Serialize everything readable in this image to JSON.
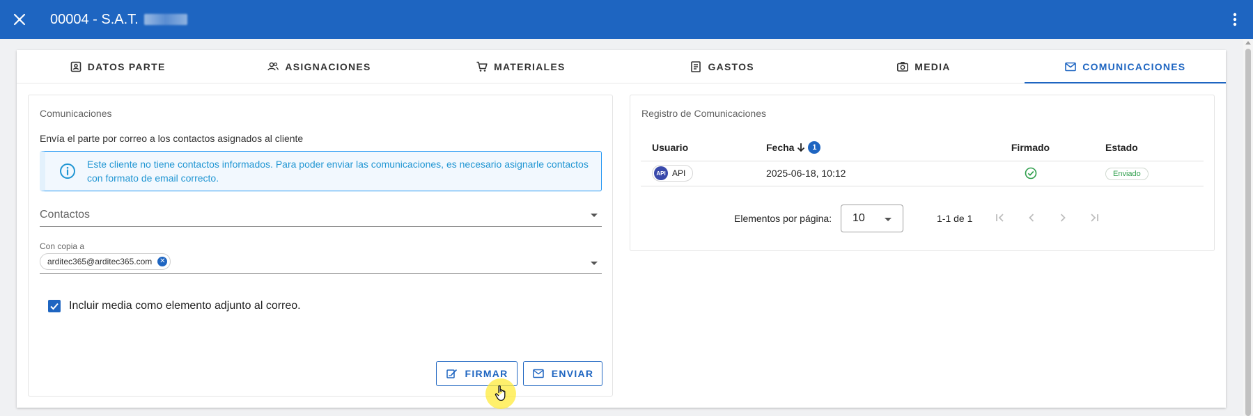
{
  "topbar": {
    "title": "00004 - S.A.T.",
    "close_icon": "close-icon",
    "menu_icon": "more-vert-icon",
    "bg_color": "#1e65c1"
  },
  "tabs": [
    {
      "label": "DATOS PARTE",
      "icon": "contact-card-icon",
      "active": false
    },
    {
      "label": "ASIGNACIONES",
      "icon": "people-icon",
      "active": false
    },
    {
      "label": "MATERIALES",
      "icon": "cart-icon",
      "active": false
    },
    {
      "label": "GASTOS",
      "icon": "receipt-icon",
      "active": false
    },
    {
      "label": "MEDIA",
      "icon": "camera-icon",
      "active": false
    },
    {
      "label": "COMUNICACIONES",
      "icon": "mail-icon",
      "active": true
    }
  ],
  "comunicaciones": {
    "title": "Comunicaciones",
    "description": "Envía el parte por correo a los contactos asignados al cliente",
    "alert_text": "Este cliente no tiene contactos informados. Para poder enviar las comunicaciones, es necesario asignarle contactos con formato de email correcto.",
    "contactos_label": "Contactos",
    "copia_label": "Con copia a",
    "copia_chip": "arditec365@arditec365.com",
    "checkbox_label": "Incluir media como elemento adjunto al correo.",
    "checkbox_checked": true,
    "firmar_label": "FIRMAR",
    "enviar_label": "ENVIAR"
  },
  "registro": {
    "title": "Registro de Comunicaciones",
    "columns": {
      "usuario": "Usuario",
      "fecha": "Fecha",
      "fecha_sort_order": "1",
      "firmado": "Firmado",
      "estado": "Estado"
    },
    "rows": [
      {
        "avatar": "API",
        "usuario": "API",
        "fecha": "2025-06-18, 10:12",
        "firmado": true,
        "estado": "Enviado"
      }
    ],
    "pagination": {
      "per_page_label": "Elementos por página:",
      "per_page_value": "10",
      "range": "1-1 de 1"
    }
  },
  "colors": {
    "accent": "#1e65c1",
    "info": "#2196d3",
    "success": "#2e9e4b"
  }
}
